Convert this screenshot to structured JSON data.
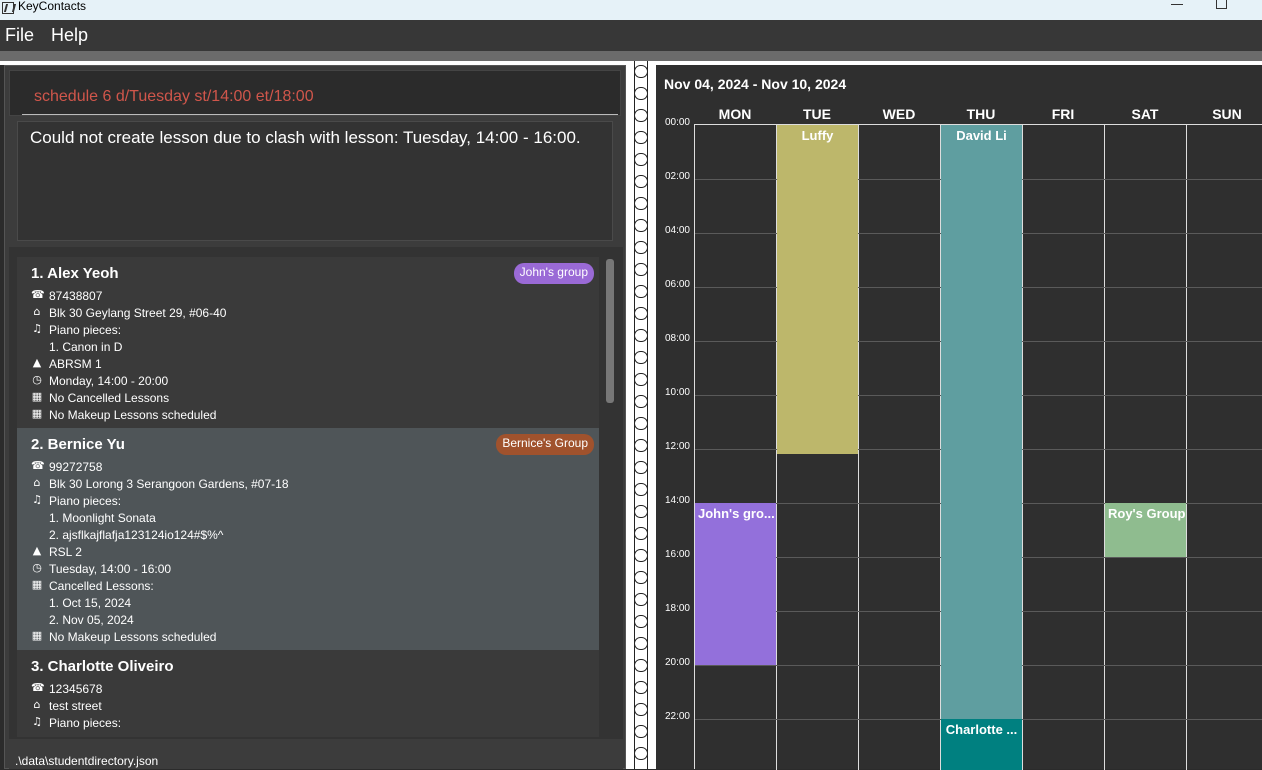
{
  "window": {
    "title": "KeyContacts"
  },
  "menu": {
    "items": [
      "File",
      "Help"
    ]
  },
  "command": {
    "value": "schedule 6 d/Tuesday st/14:00 et/18:00"
  },
  "result": {
    "message": "Could not create lesson due to clash with lesson: Tuesday, 14:00 - 16:00."
  },
  "students": [
    {
      "name": "1. Alex Yeoh",
      "group": "John's group",
      "group_color": "#9a6ad6",
      "phone": "87438807",
      "address": "Blk 30 Geylang Street 29, #06-40",
      "pieces_label": "Piano pieces:",
      "pieces": [
        "1. Canon in D"
      ],
      "grade": "ABRSM 1",
      "lesson": "Monday, 14:00 - 20:00",
      "cancelled_label": "No Cancelled Lessons",
      "cancelled": [],
      "makeup": "No Makeup Lessons scheduled"
    },
    {
      "name": "2. Bernice Yu",
      "group": "Bernice's Group",
      "group_color": "#a0522d",
      "phone": "99272758",
      "address": "Blk 30 Lorong 3 Serangoon Gardens, #07-18",
      "pieces_label": "Piano pieces:",
      "pieces": [
        "1. Moonlight Sonata",
        "2. ajsflkajflafja123124io124#$%^"
      ],
      "grade": "RSL 2",
      "lesson": "Tuesday, 14:00 - 16:00",
      "cancelled_label": "Cancelled Lessons:",
      "cancelled": [
        "1. Oct 15, 2024",
        "2. Nov 05, 2024"
      ],
      "makeup": "No Makeup Lessons scheduled"
    },
    {
      "name": "3. Charlotte Oliveiro",
      "phone": "12345678",
      "address": "test street",
      "pieces_label": "Piano pieces:"
    }
  ],
  "status": {
    "path": ".\\data\\studentdirectory.json"
  },
  "calendar": {
    "range": "Nov 04, 2024 - Nov 10, 2024",
    "days": [
      "MON",
      "TUE",
      "WED",
      "THU",
      "FRI",
      "SAT",
      "SUN"
    ],
    "times": [
      "00:00",
      "02:00",
      "04:00",
      "06:00",
      "08:00",
      "10:00",
      "12:00",
      "14:00",
      "16:00",
      "18:00",
      "20:00",
      "22:00"
    ],
    "events": [
      {
        "label": "Luffy",
        "day": 1,
        "start": 0,
        "end": 12.2,
        "color": "#bdb76b",
        "align": "center"
      },
      {
        "label": "David Li",
        "day": 3,
        "start": 0,
        "end": 22,
        "color": "#5f9ea0",
        "align": "center"
      },
      {
        "label": "John's gro...",
        "day": 0,
        "start": 14,
        "end": 20,
        "color": "#9370db",
        "align": "left"
      },
      {
        "label": "Roy's Group",
        "day": 5,
        "start": 14,
        "end": 16,
        "color": "#8fbc8f",
        "align": "left"
      },
      {
        "label": "Charlotte ...",
        "day": 3,
        "start": 22,
        "end": 24,
        "color": "#008080",
        "align": "center"
      }
    ]
  }
}
